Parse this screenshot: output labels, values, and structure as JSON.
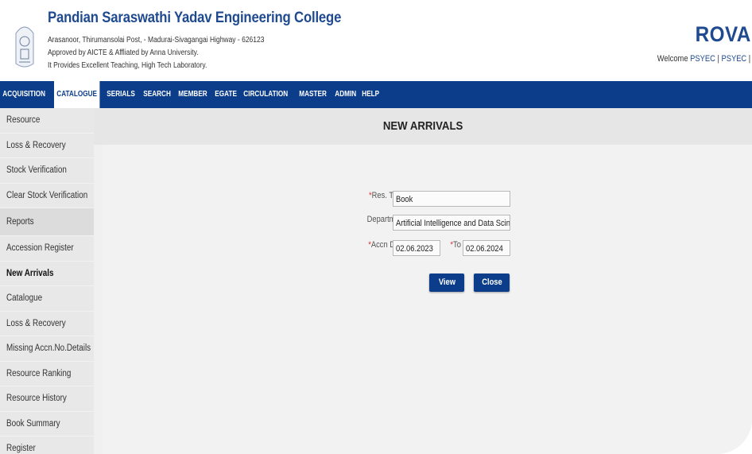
{
  "header": {
    "college_name": "Pandian Saraswathi Yadav Engineering College",
    "address_line1": "Arasanoor, Thirumansolai Post, - Madurai-Sivagangai Highway - 626123",
    "address_line2": "Approved by AICTE & Affliated by Anna University.",
    "address_line3": "It Provides Excellent Teaching, High Tech Laboratory.",
    "brand": "ROVAI",
    "welcome_prefix": "Welcome",
    "user_link1": "PSYEC",
    "separator": "|",
    "user_link2": "PSYEC",
    "separator2": "|"
  },
  "nav": {
    "items": [
      "ACQUISITION",
      "CATALOGUE",
      "SERIALS",
      "SEARCH",
      "MEMBER",
      "EGATE",
      "CIRCULATION",
      "MASTER",
      "ADMIN",
      "HELP"
    ],
    "active": "CATALOGUE"
  },
  "sidebar": {
    "items": [
      {
        "label": "Resource",
        "type": "item"
      },
      {
        "label": "Loss & Recovery",
        "type": "item"
      },
      {
        "label": "Stock Verification",
        "type": "item"
      },
      {
        "label": "Clear Stock Verification",
        "type": "item"
      },
      {
        "label": "Reports",
        "type": "section"
      },
      {
        "label": "Accession Register",
        "type": "item"
      },
      {
        "label": "New Arrivals",
        "type": "active"
      },
      {
        "label": "Catalogue",
        "type": "item"
      },
      {
        "label": "Loss & Recovery",
        "type": "item"
      },
      {
        "label": "Missing Accn.No.Details",
        "type": "item"
      },
      {
        "label": "Resource Ranking",
        "type": "item"
      },
      {
        "label": "Resource History",
        "type": "item"
      },
      {
        "label": "Book Summary",
        "type": "item"
      },
      {
        "label": "Register",
        "type": "item"
      }
    ]
  },
  "main": {
    "title": "NEW ARRIVALS",
    "form": {
      "res_type_label": "Res. Type",
      "res_type_value": "Book",
      "department_label": "Department",
      "department_value": "Artificial Intelligence and Data Scince",
      "accn_date_label": "Accn Date",
      "accn_date_from": "02.06.2023",
      "to_label": "To",
      "accn_date_to": "02.06.2024",
      "required_mark": "*",
      "view_label": "View",
      "close_label": "Close"
    }
  },
  "colors": {
    "primary": "#0c3d8a",
    "brand": "#1f4a90",
    "required": "#dd3333"
  }
}
